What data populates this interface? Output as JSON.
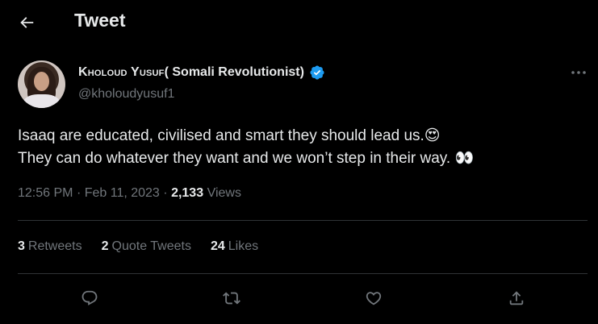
{
  "header": {
    "title": "Tweet"
  },
  "author": {
    "name_small_caps": "Kholoud Yusuf",
    "name_rest": " ( Somali Revolutionist)",
    "handle": "@kholoudyusuf1",
    "verified": true
  },
  "tweet": {
    "line1": "Isaaq are educated, civilised and smart they should lead us.",
    "line1_emoji": "😍",
    "line2": "They can do whatever they want and we won’t step in their way. ",
    "line2_emoji": "👀"
  },
  "meta": {
    "time": "12:56 PM",
    "date": "Feb 11, 2023",
    "views_count": "2,133",
    "views_label": "Views"
  },
  "stats": {
    "retweets_count": "3",
    "retweets_label": "Retweets",
    "quotes_count": "2",
    "quotes_label": "Quote Tweets",
    "likes_count": "24",
    "likes_label": "Likes"
  },
  "colors": {
    "background": "#000000",
    "text": "#e7e9ea",
    "muted": "#71767b",
    "divider": "#2f3336",
    "verified": "#1d9bf0"
  },
  "icons": [
    "back-arrow-icon",
    "verified-badge-icon",
    "more-icon",
    "reply-icon",
    "retweet-icon",
    "like-icon",
    "share-icon"
  ]
}
